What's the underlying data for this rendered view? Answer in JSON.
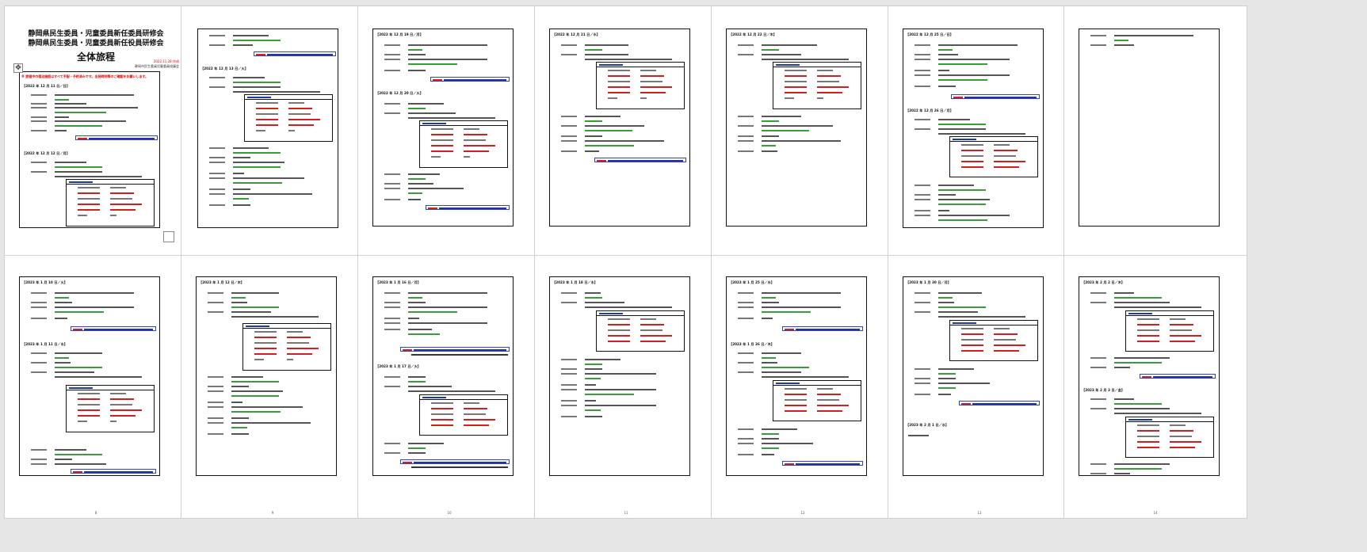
{
  "document": {
    "title_line_1": "静岡県民生委員・児童委員新任委員研修会",
    "title_line_2": "静岡県民生委員・児童委員新任役員研修会",
    "title_line_3": "全体旅程",
    "issue_date": "2022.11.28 作成",
    "organization": "静岡市民生委員児童委員協議会",
    "notice": "※ 旅程中の宿泊施設はすべて手配・予約済みです。出発時刻等のご確認をお願いします。"
  },
  "pages": [
    {
      "number": "1",
      "headers": [
        "【2022 年 12 月 11 日／日】",
        "【2022 年 12 月 12 日／月】"
      ]
    },
    {
      "number": "2",
      "headers": [
        "【2022 年 12 月 13 日／火】"
      ],
      "time_first": "17：00"
    },
    {
      "number": "3",
      "headers": [
        "【2022 年 12 月 19 日／月】",
        "【2022 年 12 月 20 日／火】"
      ]
    },
    {
      "number": "4",
      "headers": [
        "【2022 年 12 月 21 日／水】"
      ]
    },
    {
      "number": "5",
      "headers": [
        "【2022 年 12 月 22 日／木】"
      ]
    },
    {
      "number": "6",
      "headers": [
        "【2022 年 12 月 25 日／日】",
        "【2022 年 12 月 26 日／月】"
      ]
    },
    {
      "number": "7",
      "headers": []
    },
    {
      "number": "8",
      "headers": [
        "【2023 年 1 月 10 日／火】",
        "【2023 年 1 月 11 日／水】"
      ]
    },
    {
      "number": "9",
      "headers": [
        "【2023 年 1 月 12 日／木】"
      ]
    },
    {
      "number": "10",
      "headers": [
        "【2023 年 1 月 16 日／月】",
        "【2023 年 1 月 17 日／火】"
      ]
    },
    {
      "number": "11",
      "headers": [
        "【2023 年 1 月 18 日／水】"
      ]
    },
    {
      "number": "12",
      "headers": [
        "【2023 年 1 月 25 日／水】",
        "【2023 年 1 月 26 日／木】"
      ]
    },
    {
      "number": "13",
      "headers": [
        "【2023 年 1 月 30 日／月】",
        "【2023 年 2 月 1 日／水】"
      ]
    },
    {
      "number": "14",
      "headers": [
        "【2023 年 2 月 2 日／木】",
        "【2023 年 2 月 3 日／金】"
      ]
    }
  ],
  "icons": {
    "move_handle": "move-handle-icon",
    "resize_handle": "resize-handle-icon"
  },
  "colors": {
    "accent_red": "#d21f1f",
    "accent_green": "#3a9d3a",
    "accent_blue": "#2233aa"
  }
}
